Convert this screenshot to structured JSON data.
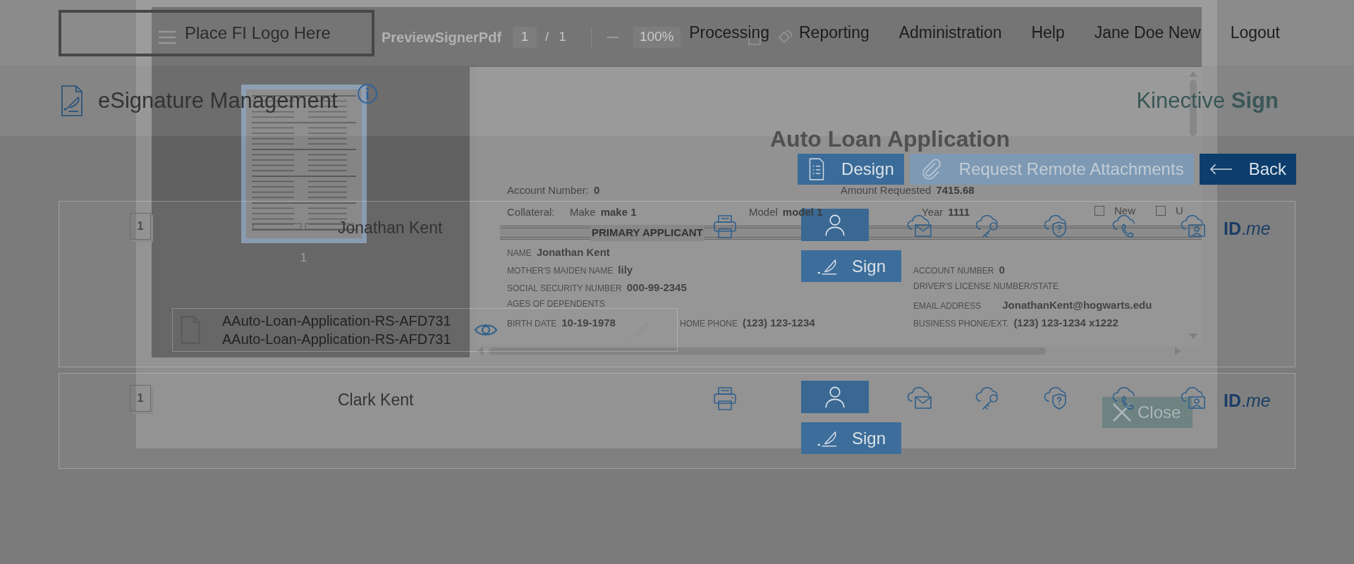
{
  "header": {
    "logo_placeholder": "Place FI Logo Here",
    "nav": [
      {
        "label": "Processing"
      },
      {
        "label": "Reporting"
      },
      {
        "label": "Administration"
      },
      {
        "label": "Help"
      },
      {
        "label": "Jane Doe New"
      },
      {
        "label": "Logout"
      }
    ]
  },
  "subheader": {
    "title": "eSignature Management",
    "brand": "Kinective **Sign**"
  },
  "actions": [
    {
      "kind": "design",
      "label": "Design",
      "disabled": false
    },
    {
      "kind": "attach",
      "label": "Request Remote Attachments",
      "disabled": true
    },
    {
      "kind": "back",
      "label": "Back",
      "disabled": false
    }
  ],
  "signers": [
    {
      "page_badge": "1",
      "name": "Jonathan Kent",
      "sign_label": "Sign",
      "idme": "**ID**.*me*",
      "documents": [
        {
          "lines": [
            "AAuto-Loan-Application-RS-AFD731",
            "AAuto-Loan-Application-RS-AFD731"
          ]
        }
      ]
    },
    {
      "page_badge": "1",
      "name": "Clark Kent",
      "sign_label": "Sign",
      "idme": "**ID**.*me*"
    }
  ],
  "viewer": {
    "title": "PreviewSignerPdf",
    "page": "1",
    "page_separator": "/",
    "page_total": "1",
    "zoom": "100%",
    "thumbnails": [
      {
        "label": "1",
        "selected": true
      }
    ],
    "document": {
      "title": "Auto Loan Application",
      "top_fields": [
        {
          "label": "Account Number:",
          "value": "0"
        },
        {
          "label": "Amount Requested",
          "value": "7415.68"
        }
      ],
      "collateral": {
        "label": "Collateral:",
        "fields": [
          {
            "label": "Make",
            "value": "make 1"
          },
          {
            "label": "Model",
            "value": "model 1"
          },
          {
            "label": "Year",
            "value": "1111"
          }
        ],
        "options": [
          {
            "label": "New",
            "checked": false
          },
          {
            "label": "U",
            "checked": false
          }
        ]
      },
      "section": "PRIMARY APPLICANT",
      "left_rows": [
        [
          {
            "label": "NAME",
            "value": "Jonathan Kent"
          }
        ],
        [
          {
            "label": "MOTHER'S MAIDEN NAME",
            "value": "lily"
          }
        ],
        [
          {
            "label": "SOCIAL SECURITY NUMBER",
            "value": "000-99-2345"
          }
        ],
        [
          {
            "label": "AGES OF DEPENDENTS"
          }
        ],
        [
          {
            "label": "BIRTH DATE",
            "value": "10-19-1978"
          },
          {
            "label": "HOME PHONE",
            "value": "(123) 123-1234"
          }
        ]
      ],
      "right_fields": [
        {
          "label": "ACCOUNT NUMBER",
          "value": "0"
        },
        {
          "label": "DRIVER'S LICENSE NUMBER/STATE"
        },
        {
          "label": "EMAIL ADDRESS",
          "value": "JonathanKent@hogwarts.edu"
        },
        {
          "label": "BUSINESS PHONE/EXT.",
          "value": "(123) 123-1234 x1222"
        }
      ]
    },
    "close": "Close"
  }
}
